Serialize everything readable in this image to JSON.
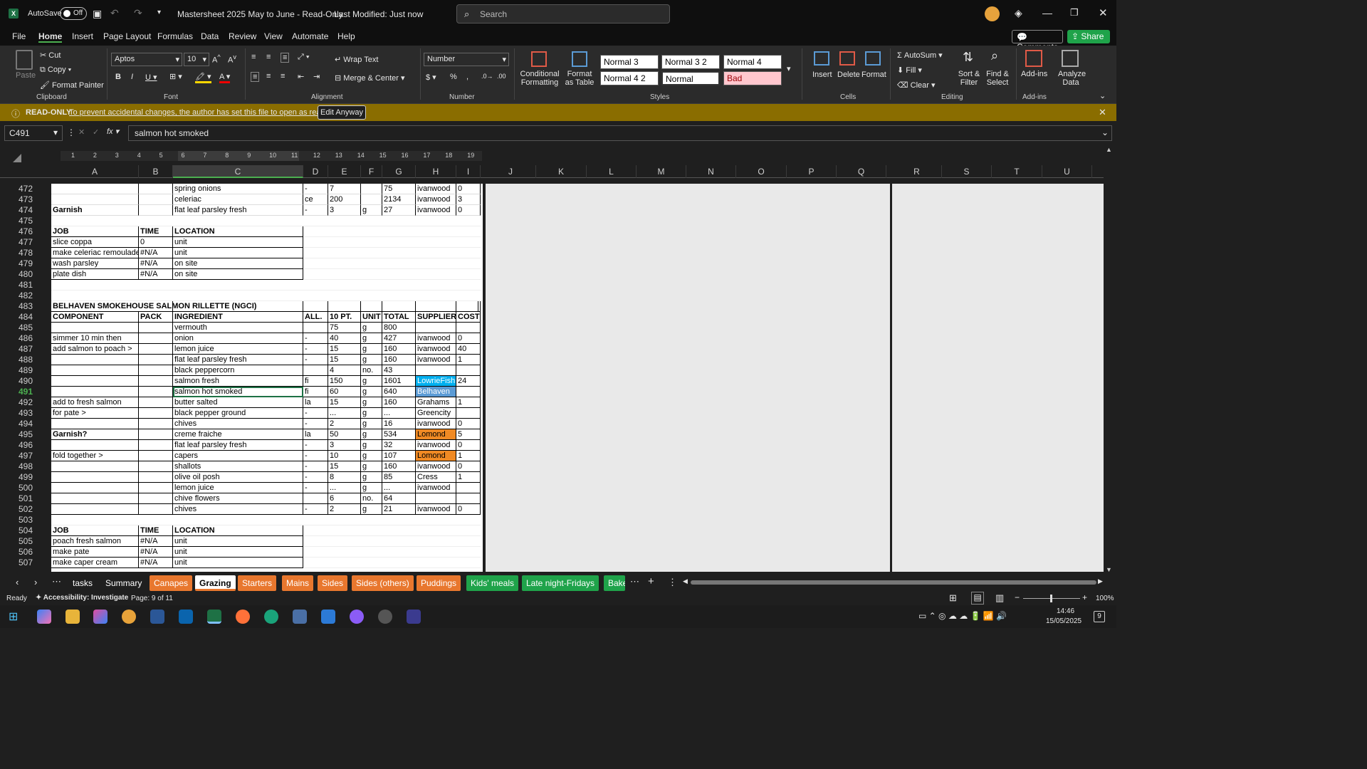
{
  "title_bar": {
    "autosave_label": "AutoSave",
    "autosave_state": "Off",
    "document_title": "Mastersheet 2025 May to June  -  Read-Only",
    "modified": "Last Modified: Just now",
    "search_placeholder": "Search"
  },
  "menu": [
    "File",
    "Home",
    "Insert",
    "Page Layout",
    "Formulas",
    "Data",
    "Review",
    "View",
    "Automate",
    "Help"
  ],
  "menu_right": {
    "comments": "Comments",
    "share": "Share"
  },
  "ribbon": {
    "clipboard": {
      "paste": "Paste",
      "cut": "Cut",
      "copy": "Copy",
      "format_painter": "Format Painter",
      "label": "Clipboard"
    },
    "font": {
      "name": "Aptos",
      "size": "10",
      "label": "Font"
    },
    "alignment": {
      "wrap": "Wrap Text",
      "merge": "Merge & Center",
      "label": "Alignment"
    },
    "number": {
      "format": "Number",
      "label": "Number"
    },
    "styles": {
      "conditional": "Conditional Formatting",
      "format_table": "Format as Table",
      "cells": [
        "Normal 3",
        "Normal 3 2",
        "Normal 4",
        "Normal 4 2",
        "Normal",
        "Bad"
      ],
      "label": "Styles"
    },
    "cells": {
      "insert": "Insert",
      "delete": "Delete",
      "format": "Format",
      "label": "Cells"
    },
    "editing": {
      "autosum": "AutoSum",
      "fill": "Fill",
      "clear": "Clear",
      "sort": "Sort & Filter",
      "find": "Find & Select",
      "label": "Editing"
    },
    "addins": {
      "addins": "Add-ins",
      "analyze": "Analyze Data",
      "label": "Add-ins"
    }
  },
  "infobar": {
    "badge": "READ-ONLY",
    "message": "To prevent accidental changes, the author has set this file to open as read-only.",
    "button": "Edit Anyway"
  },
  "formula_bar": {
    "name_box": "C491",
    "formula": "salmon hot smoked"
  },
  "ruler_ticks": [
    "1",
    "2",
    "3",
    "4",
    "5",
    "6",
    "7",
    "8",
    "9",
    "10",
    "11",
    "12",
    "13",
    "14",
    "15",
    "16",
    "17",
    "18",
    "19"
  ],
  "columns": [
    "A",
    "B",
    "C",
    "D",
    "E",
    "F",
    "G",
    "H",
    "I",
    "J",
    "K",
    "L",
    "M",
    "N",
    "O",
    "P",
    "Q",
    "R",
    "S",
    "T",
    "U"
  ],
  "rows": [
    {
      "n": "472",
      "cells": [
        "",
        "",
        "spring onions",
        "-",
        "7",
        "",
        "75",
        "ivanwood",
        "0"
      ]
    },
    {
      "n": "473",
      "cells": [
        "",
        "",
        "celeriac",
        "ce",
        "200",
        "",
        "2134",
        "ivanwood",
        "3"
      ]
    },
    {
      "n": "474",
      "cells": [
        "Garnish",
        "",
        "flat leaf parsley fresh",
        "-",
        "3",
        "g",
        "27",
        "ivanwood",
        "0"
      ]
    },
    {
      "n": "475",
      "cells": [
        "",
        "",
        "",
        "",
        "",
        "",
        "",
        "",
        ""
      ]
    },
    {
      "n": "476",
      "cells": [
        "JOB",
        "TIME",
        "LOCATION",
        "",
        "",
        "",
        "",
        "",
        ""
      ]
    },
    {
      "n": "477",
      "cells": [
        "slice coppa",
        "0",
        "unit",
        "",
        "",
        "",
        "",
        "",
        ""
      ]
    },
    {
      "n": "478",
      "cells": [
        "make celeriac remoulade",
        "#N/A",
        "unit",
        "",
        "",
        "",
        "",
        "",
        ""
      ]
    },
    {
      "n": "479",
      "cells": [
        "wash parsley",
        "#N/A",
        "on site",
        "",
        "",
        "",
        "",
        "",
        ""
      ]
    },
    {
      "n": "480",
      "cells": [
        "plate dish",
        "#N/A",
        "on site",
        "",
        "",
        "",
        "",
        "",
        ""
      ]
    },
    {
      "n": "481",
      "cells": [
        "",
        "",
        "",
        "",
        "",
        "",
        "",
        "",
        ""
      ]
    },
    {
      "n": "482",
      "cells": [
        "",
        "",
        "",
        "",
        "",
        "",
        "",
        "",
        ""
      ]
    },
    {
      "n": "483",
      "cells": [
        "BELHAVEN SMOKEHOUSE SALMON RILLETTE (NGCI)",
        "",
        "",
        "",
        "",
        "",
        "",
        "",
        ""
      ]
    },
    {
      "n": "484",
      "cells": [
        "COMPONENT",
        "PACK",
        "INGREDIENT",
        "ALL.",
        "10 PT.",
        "UNIT",
        "TOTAL",
        "SUPPLIER",
        "COST"
      ]
    },
    {
      "n": "485",
      "cells": [
        "",
        "",
        "vermouth",
        "",
        "75",
        "g",
        "800",
        "",
        ""
      ]
    },
    {
      "n": "486",
      "cells": [
        "simmer 10 min then",
        "",
        "onion",
        "-",
        "40",
        "g",
        "427",
        "ivanwood",
        "0"
      ]
    },
    {
      "n": "487",
      "cells": [
        "add salmon to poach >",
        "",
        "lemon juice",
        "-",
        "15",
        "g",
        "160",
        "ivanwood",
        "40"
      ]
    },
    {
      "n": "488",
      "cells": [
        "",
        "",
        "flat leaf parsley fresh",
        "-",
        "15",
        "g",
        "160",
        "ivanwood",
        "1"
      ]
    },
    {
      "n": "489",
      "cells": [
        "",
        "",
        "black peppercorn",
        "",
        "4",
        "no.",
        "43",
        "",
        ""
      ]
    },
    {
      "n": "490",
      "cells": [
        "",
        "",
        "salmon fresh",
        "fi",
        "150",
        "g",
        "1601",
        "LowrieFish",
        "24"
      ]
    },
    {
      "n": "491",
      "cells": [
        "",
        "",
        "salmon hot smoked",
        "fi",
        "60",
        "g",
        "640",
        "Belhaven",
        ""
      ]
    },
    {
      "n": "492",
      "cells": [
        "add to fresh salmon",
        "",
        "butter salted",
        "la",
        "15",
        "g",
        "160",
        "Grahams",
        "1"
      ]
    },
    {
      "n": "493",
      "cells": [
        "for pate >",
        "",
        "black pepper ground",
        "-",
        "...",
        "g",
        "...",
        "Greencity",
        ""
      ]
    },
    {
      "n": "494",
      "cells": [
        "",
        "",
        "chives",
        "-",
        "2",
        "g",
        "16",
        "ivanwood",
        "0"
      ]
    },
    {
      "n": "495",
      "cells": [
        "Garnish?",
        "",
        "creme fraiche",
        "la",
        "50",
        "g",
        "534",
        "Lomond",
        "5"
      ]
    },
    {
      "n": "496",
      "cells": [
        "",
        "",
        "flat leaf parsley fresh",
        "-",
        "3",
        "g",
        "32",
        "ivanwood",
        "0"
      ]
    },
    {
      "n": "497",
      "cells": [
        "fold together >",
        "",
        "capers",
        "-",
        "10",
        "g",
        "107",
        "Lomond",
        "1"
      ]
    },
    {
      "n": "498",
      "cells": [
        "",
        "",
        "shallots",
        "-",
        "15",
        "g",
        "160",
        "ivanwood",
        "0"
      ]
    },
    {
      "n": "499",
      "cells": [
        "",
        "",
        "olive oil posh",
        "-",
        "8",
        "g",
        "85",
        "Cress",
        "1"
      ]
    },
    {
      "n": "500",
      "cells": [
        "",
        "",
        "lemon juice",
        "-",
        "...",
        "g",
        "...",
        "ivanwood",
        ""
      ]
    },
    {
      "n": "501",
      "cells": [
        "",
        "",
        "chive flowers",
        "",
        "6",
        "no.",
        "64",
        "",
        ""
      ]
    },
    {
      "n": "502",
      "cells": [
        "",
        "",
        "chives",
        "-",
        "2",
        "g",
        "21",
        "ivanwood",
        "0"
      ]
    },
    {
      "n": "503",
      "cells": [
        "",
        "",
        "",
        "",
        "",
        "",
        "",
        "",
        ""
      ]
    },
    {
      "n": "504",
      "cells": [
        "JOB",
        "TIME",
        "LOCATION",
        "",
        "",
        "",
        "",
        "",
        ""
      ]
    },
    {
      "n": "505",
      "cells": [
        "poach fresh salmon",
        "#N/A",
        "unit",
        "",
        "",
        "",
        "",
        "",
        ""
      ]
    },
    {
      "n": "506",
      "cells": [
        "make pate",
        "#N/A",
        "unit",
        "",
        "",
        "",
        "",
        "",
        ""
      ]
    },
    {
      "n": "507",
      "cells": [
        "make caper cream",
        "#N/A",
        "unit",
        "",
        "",
        "",
        "",
        "",
        ""
      ]
    }
  ],
  "supplier_colors": {
    "LowrieFish": "#00b0f0",
    "Belhaven": "#5b9bd5",
    "Lomond": "#f08a24"
  },
  "sheet_tabs": [
    {
      "label": "tasks",
      "color": "none"
    },
    {
      "label": "Summary",
      "color": "none"
    },
    {
      "label": "Canapes",
      "color": "#e8772e"
    },
    {
      "label": "Grazing",
      "color": "active"
    },
    {
      "label": "Starters",
      "color": "#e8772e"
    },
    {
      "label": "Mains",
      "color": "#e8772e"
    },
    {
      "label": "Sides",
      "color": "#e8772e"
    },
    {
      "label": "Sides (others)",
      "color": "#e8772e"
    },
    {
      "label": "Puddings",
      "color": "#e8772e"
    },
    {
      "label": "Kids' meals",
      "color": "#1fa34a"
    },
    {
      "label": "Late night-Fridays",
      "color": "#1fa34a"
    },
    {
      "label": "Bake",
      "color": "#1fa34a"
    }
  ],
  "status": {
    "ready": "Ready",
    "accessibility": "Accessibility: Investigate",
    "page": "Page: 9 of 11",
    "zoom": "100%"
  },
  "taskbar": {
    "time": "14:46",
    "date": "15/05/2025",
    "notifications": "9"
  }
}
